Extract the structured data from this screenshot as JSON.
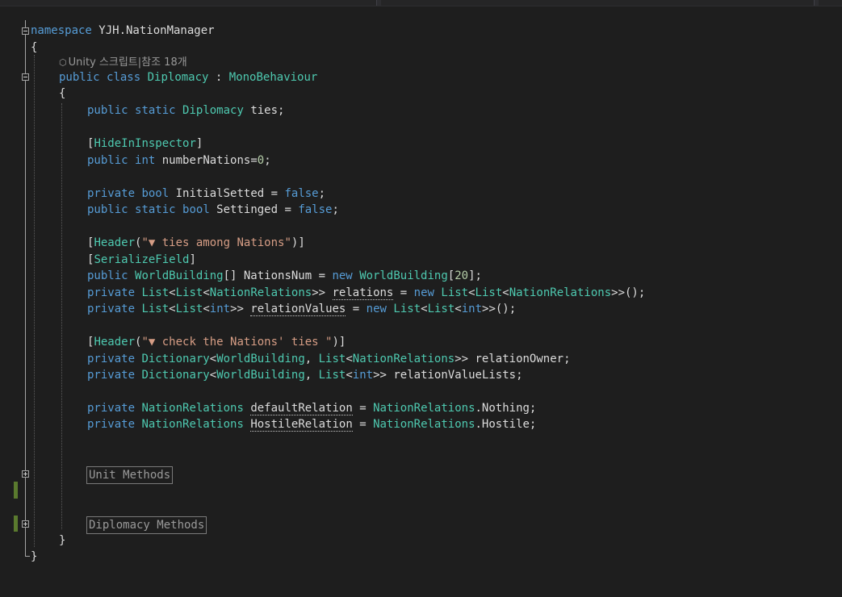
{
  "editor": {
    "codelens": {
      "text": "Unity 스크립트|참조 18개",
      "icon": "unity-cube-icon"
    },
    "lines": {
      "ns_kw": "namespace",
      "ns_name": " YJH.NationManager",
      "open_ns": "{",
      "cls_public": "public",
      "cls_class": "class",
      "cls_name": "Diplomacy",
      "cls_colon": " : ",
      "cls_base": "MonoBehaviour",
      "open_cls": "{",
      "l1_public": "public",
      "l1_static": "static",
      "l1_type": "Diplomacy",
      "l1_rest": " ties;",
      "l2_open": "[",
      "l2_attr": "HideInInspector",
      "l2_close": "]",
      "l3_public": "public",
      "l3_int": "int",
      "l3_rest": " numberNations=",
      "l3_num": "0",
      "l3_end": ";",
      "l4_private": "private",
      "l4_bool": "bool",
      "l4_rest": " InitialSetted = ",
      "l4_false": "false",
      "l4_end": ";",
      "l5_public": "public",
      "l5_static": "static",
      "l5_bool": "bool",
      "l5_rest": " Settinged = ",
      "l5_false": "false",
      "l5_end": ";",
      "l6_open": "[",
      "l6_attr": "Header",
      "l6_paren": "(",
      "l6_str": "\"▼ ties among Nations\"",
      "l6_close": ")]",
      "l7_open": "[",
      "l7_attr": "SerializeField",
      "l7_close": "]",
      "l8_public": "public",
      "l8_type": "WorldBuilding",
      "l8_rest": "[] NationsNum = ",
      "l8_new": "new",
      "l8_type2": "WorldBuilding",
      "l8_br": "[",
      "l8_num": "20",
      "l8_end": "];",
      "l9_private": "private",
      "l9_list": "List",
      "l9_lt": "<",
      "l9_list2": "List",
      "l9_lt2": "<",
      "l9_nr": "NationRelations",
      "l9_gt": ">> ",
      "l9_var": "relations",
      "l9_eq": " = ",
      "l9_new": "new",
      "l9_list3": "List",
      "l9_lt3": "<",
      "l9_list4": "List",
      "l9_lt4": "<",
      "l9_nr2": "NationRelations",
      "l9_end": ">>();",
      "l10_private": "private",
      "l10_list": "List",
      "l10_lt": "<",
      "l10_list2": "List",
      "l10_lt2": "<",
      "l10_int": "int",
      "l10_gt": ">> ",
      "l10_var": "relationValues",
      "l10_eq": " = ",
      "l10_new": "new",
      "l10_list3": "List",
      "l10_lt3": "<",
      "l10_list4": "List",
      "l10_lt4": "<",
      "l10_int2": "int",
      "l10_end": ">>();",
      "l11_open": "[",
      "l11_attr": "Header",
      "l11_paren": "(",
      "l11_str": "\"▼ check the Nations' ties \"",
      "l11_close": ")]",
      "l12_private": "private",
      "l12_dict": "Dictionary",
      "l12_lt": "<",
      "l12_wb": "WorldBuilding",
      "l12_comma": ", ",
      "l12_list": "List",
      "l12_lt2": "<",
      "l12_nr": "NationRelations",
      "l12_end": ">> relationOwner;",
      "l13_private": "private",
      "l13_dict": "Dictionary",
      "l13_lt": "<",
      "l13_wb": "WorldBuilding",
      "l13_comma": ", ",
      "l13_list": "List",
      "l13_lt2": "<",
      "l13_int": "int",
      "l13_end": ">> relationValueLists;",
      "l14_private": "private",
      "l14_type": "NationRelations",
      "l14_sp": " ",
      "l14_var": "defaultRelation",
      "l14_eq": " = ",
      "l14_type2": "NationRelations",
      "l14_end": ".Nothing;",
      "l15_private": "private",
      "l15_type": "NationRelations",
      "l15_sp": " ",
      "l15_var": "HostileRelation",
      "l15_eq": " = ",
      "l15_type2": "NationRelations",
      "l15_end": ".Hostile;",
      "region1": "Unit Methods",
      "region2": "Diplomacy Methods",
      "close_cls": "}",
      "close_ns": "}"
    }
  }
}
